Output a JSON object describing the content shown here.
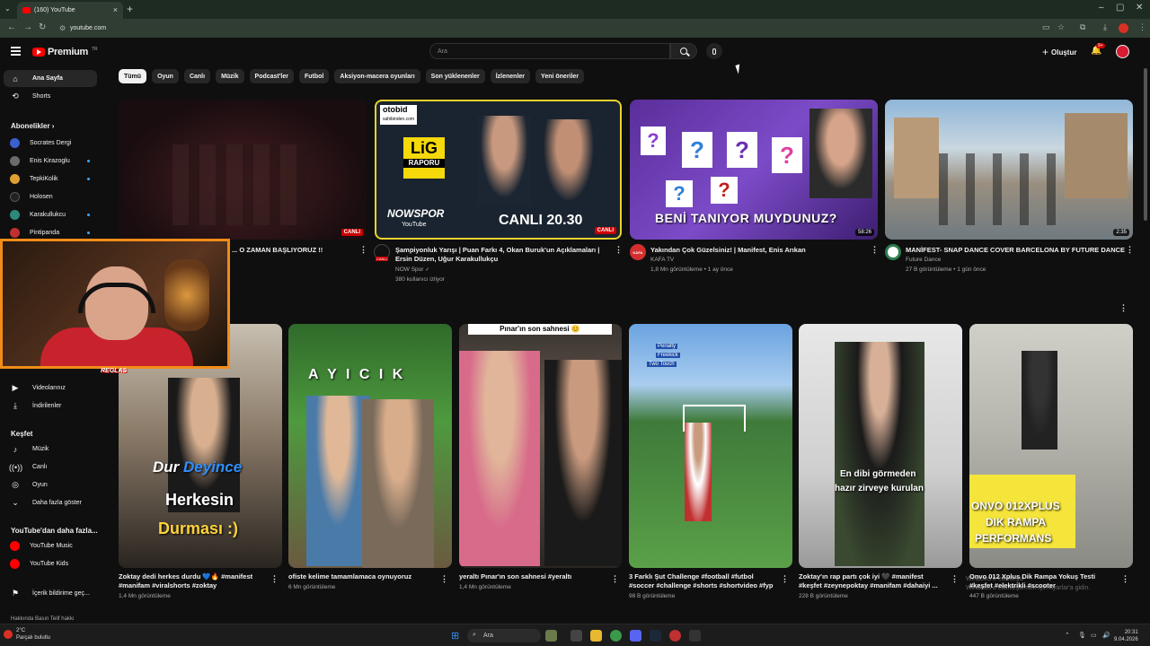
{
  "browser": {
    "tab_title": "(160) YouTube",
    "url": "youtube.com"
  },
  "masthead": {
    "brand": "Premium",
    "brand_sup": "TR",
    "search_placeholder": "Ara",
    "create_label": "Oluştur",
    "notif_count": "9+"
  },
  "chips": [
    "Tümü",
    "Oyun",
    "Canlı",
    "Müzik",
    "Podcast'ler",
    "Futbol",
    "Aksiyon-macera oyunları",
    "Son yüklenenler",
    "İzlenenler",
    "Yeni öneriler"
  ],
  "sidebar": {
    "home": "Ana Sayfa",
    "shorts": "Shorts",
    "subs_heading": "Abonelikler",
    "subscriptions": [
      {
        "name": "Socrates Dergi",
        "color": "#3a5fcf"
      },
      {
        "name": "Enis Kirazoglu",
        "color": "#6b6b6b"
      },
      {
        "name": "TepkiKolik",
        "color": "#e0a030"
      },
      {
        "name": "Holosen",
        "color": "#222222"
      },
      {
        "name": "Karakullukcu",
        "color": "#2b8a7a"
      },
      {
        "name": "Pintipanda",
        "color": "#c03030"
      }
    ],
    "your_videos": "Videolarınız",
    "downloads": "İndirilenler",
    "explore_heading": "Keşfet",
    "explore": [
      "Müzik",
      "Canlı",
      "Oyun",
      "Daha fazla göster"
    ],
    "more_heading": "YouTube'dan daha fazla...",
    "more": [
      "YouTube Music",
      "YouTube Kids"
    ],
    "feedback": "İçerik bildirime geç...",
    "footer": "Hakkında  Basın  Telif hakkı"
  },
  "videos": [
    {
      "title": "... O ZAMAN BAŞLIYORUZ !!",
      "channel": "",
      "meta": "",
      "badge": "CANLI"
    },
    {
      "title": "Şampiyonluk Yarışı | Puan Farkı 4, Okan Buruk'un Açıklamaları | Ersin Düzen, Uğur Karakullukçu",
      "channel": "NOW Spor",
      "meta": "380 kullanıcı izliyor",
      "badge": "CANLI",
      "thumb_top": "otobid",
      "thumb_sub": "sahibinden.com",
      "thumb_lig": "LiG",
      "thumb_raporu": "RAPORU",
      "thumb_now": "NOWSPOR",
      "thumb_yt": "YouTube",
      "thumb_time": "CANLI 20.30"
    },
    {
      "title": "Yakından Çok Güzelsiniz! | Manifest, Enis Arıkan",
      "channel": "KAFA TV",
      "meta": "1,8 Mn görüntüleme • 1 ay önce",
      "duration": "58:26",
      "thumb_caption": "BENİ TANIYOR MUYDUNUZ?",
      "av_label": "KAFA"
    },
    {
      "title": "MANİFEST- SNAP DANCE COVER BARCELONA BY FUTURE DANCE",
      "channel": "Future Dance",
      "meta": "27 B görüntüleme • 1 gün önce",
      "duration": "2:35"
    }
  ],
  "shorts": [
    {
      "title": "Zoktay dedi herkes durdu 💙🔥 #manifest #manifam #viralshorts #zoktay",
      "meta": "1,4 Mn görüntüleme",
      "overlay1": "Dur",
      "overlay2": "Deyince",
      "overlay3": "Herkesin",
      "overlay4": "Durması :)"
    },
    {
      "title": "ofiste kelime tamamlamaca oynuyoruz",
      "meta": "6 Mn görüntüleme",
      "overlay1": "A Y I C I K"
    },
    {
      "title": "yeraltı Pınar'ın son sahnesi #yeraltı",
      "meta": "1,4 Mn görüntüleme",
      "overlay1": "Pınar'ın son sahnesi 😊"
    },
    {
      "title": "3 Farklı Şut Challenge  #football #futbol #soccer #challenge #shorts #shortvideo #fyp",
      "meta": "98 B görüntüleme",
      "overlay1": "Penalty",
      "overlay2": "Freekick",
      "overlay3": "Two Touch"
    },
    {
      "title": "Zoktay'ın rap partı çok iyi 🖤  #manifest #keşfet #zeynepoktay #manifam #dahaiyi ...",
      "meta": "228 B görüntüleme",
      "overlay1": "En dibi görmeden",
      "overlay2": "hazır zirveye kurulan"
    },
    {
      "title": "Onvo 012 Xplus Dik Rampa Yokuş Testi #keşfet #elektrikli #scooter",
      "meta": "447 B görüntüleme",
      "overlay1": "ONVO 012XPLUS",
      "overlay2": "DIK RAMPA",
      "overlay3": "PERFORMANS"
    }
  ],
  "activate_windows": {
    "line1": "Windows'u etkinleştir",
    "line2": "Windows'u etkinleştirmek için Ayarlar'a gidin."
  },
  "taskbar": {
    "weather_temp": "2°C",
    "weather_desc": "Parçalı bulutlu",
    "search": "Ara",
    "time": "20:31",
    "date": "9.04.2026"
  },
  "webcam_logo": "REGLAS",
  "colors": {
    "accent": "#ff0000",
    "cam_border": "#f28c18",
    "live": "#cc0000"
  }
}
